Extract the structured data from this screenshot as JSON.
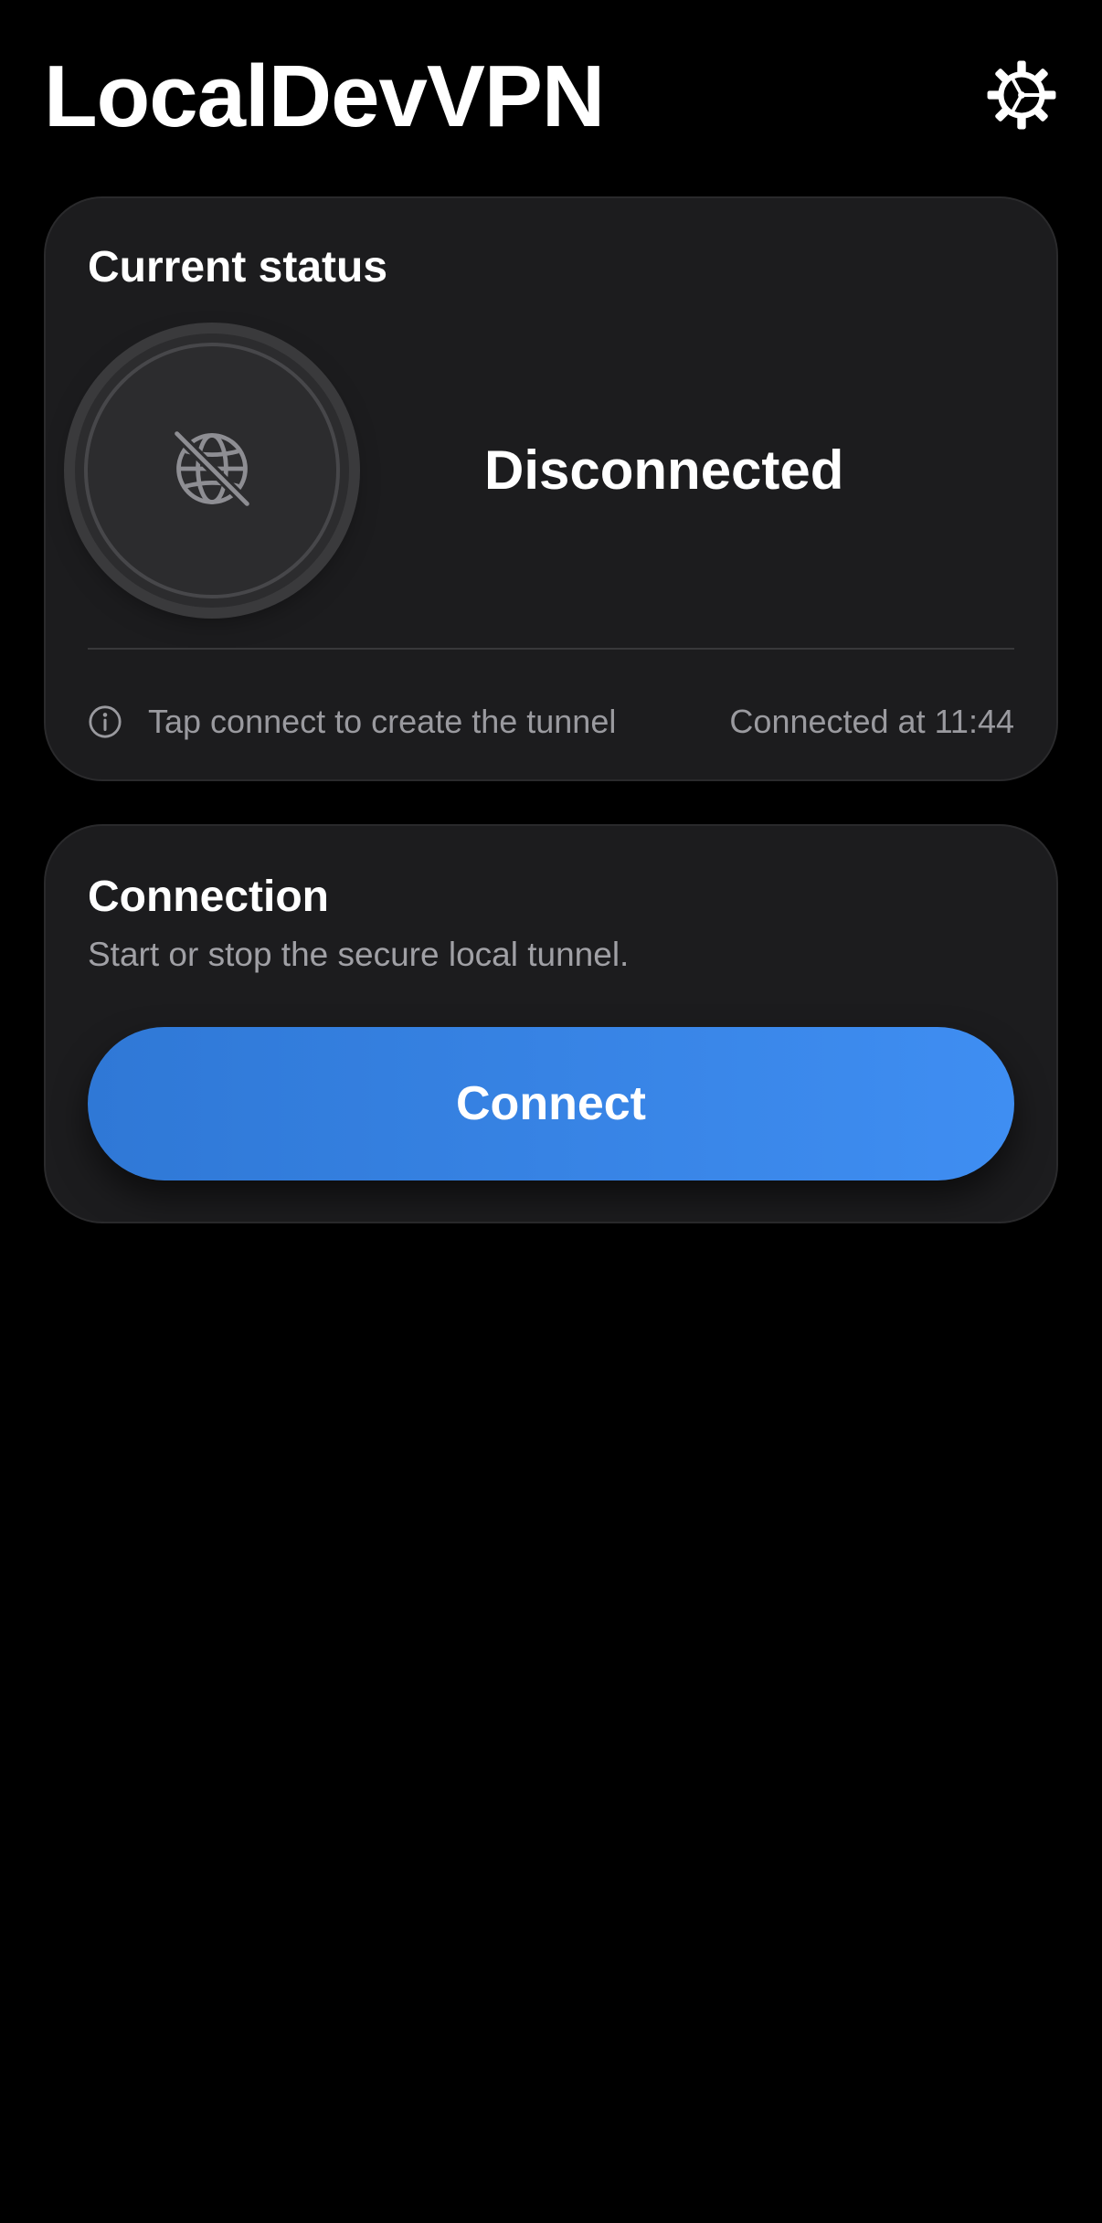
{
  "app": {
    "title": "LocalDevVPN"
  },
  "header": {
    "settings_icon": "gear-icon"
  },
  "status_card": {
    "title": "Current status",
    "indicator_icon": "globe-slash-icon",
    "status": "Disconnected",
    "hint_icon": "info-icon",
    "hint": "Tap connect to create the tunnel",
    "connected_at": "Connected at 11:44"
  },
  "connection_card": {
    "title": "Connection",
    "subtitle": "Start or stop the secure local tunnel.",
    "button_label": "Connect"
  },
  "colors": {
    "background": "#000000",
    "card": "#1c1c1e",
    "accent_start": "#2f78d6",
    "accent_end": "#3f8ef2",
    "secondary_text": "#9a9a9f"
  }
}
